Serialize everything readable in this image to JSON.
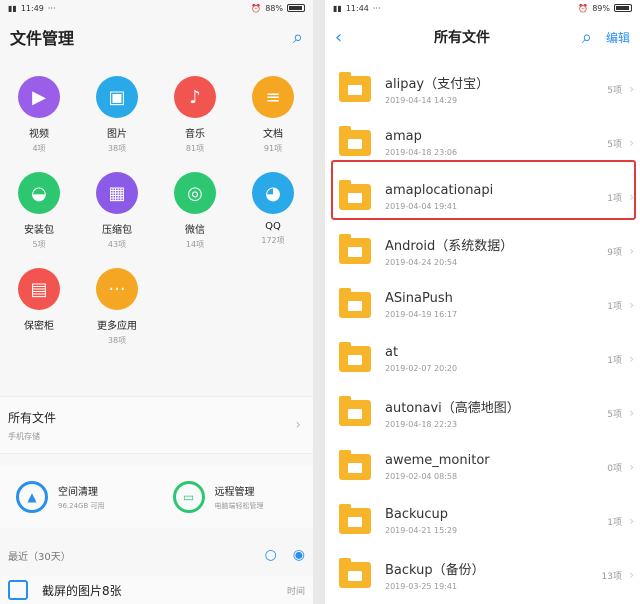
{
  "left": {
    "status": {
      "time": "11:49",
      "battery": "88%"
    },
    "title": "文件管理",
    "categories": [
      {
        "name": "视频",
        "count": "4项",
        "color": "#9b5ee8",
        "icon": "play-icon"
      },
      {
        "name": "图片",
        "count": "38项",
        "color": "#2aa9e8",
        "icon": "image-icon"
      },
      {
        "name": "音乐",
        "count": "81项",
        "color": "#f2554f",
        "icon": "music-icon"
      },
      {
        "name": "文档",
        "count": "91项",
        "color": "#f5a623",
        "icon": "document-icon"
      },
      {
        "name": "安装包",
        "count": "5项",
        "color": "#2ec771",
        "icon": "android-icon"
      },
      {
        "name": "压缩包",
        "count": "43项",
        "color": "#8b5be8",
        "icon": "archive-icon"
      },
      {
        "name": "微信",
        "count": "14项",
        "color": "#2ec771",
        "icon": "wechat-icon"
      },
      {
        "name": "QQ",
        "count": "172项",
        "color": "#2aa9e8",
        "icon": "qq-icon"
      },
      {
        "name": "保密柜",
        "count": "",
        "color": "#f2554f",
        "icon": "safe-icon"
      },
      {
        "name": "更多应用",
        "count": "38项",
        "color": "#f5a623",
        "icon": "more-icon"
      }
    ],
    "all_files": {
      "title": "所有文件",
      "sub": "手机存储"
    },
    "tools": [
      {
        "title": "空间清理",
        "sub": "96.24GB 可用",
        "color": "#2a8ef0"
      },
      {
        "title": "远程管理",
        "sub": "电脑端轻松管理",
        "color": "#2ec771"
      }
    ],
    "recent": {
      "label": "最近（30天）"
    },
    "screenshot_row": {
      "label": "截屏的图片8张",
      "time": "时间"
    }
  },
  "right": {
    "status": {
      "time": "11:44",
      "battery": "89%"
    },
    "title": "所有文件",
    "edit": "编辑",
    "files": [
      {
        "name": "alipay（支付宝）",
        "date": "2019-04-14 14:29",
        "count": "5项"
      },
      {
        "name": "amap",
        "date": "2019-04-18 23:06",
        "count": "5项"
      },
      {
        "name": "amaplocationapi",
        "date": "2019-04-04 19:41",
        "count": "1项"
      },
      {
        "name": "Android（系统数据）",
        "date": "2019-04-24 20:54",
        "count": "9项"
      },
      {
        "name": "ASinaPush",
        "date": "2019-04-19 16:17",
        "count": "1项"
      },
      {
        "name": "at",
        "date": "2019-02-07 20:20",
        "count": "1项"
      },
      {
        "name": "autonavi（高德地图）",
        "date": "2019-04-18 22:23",
        "count": "5项"
      },
      {
        "name": "aweme_monitor",
        "date": "2019-02-04 08:58",
        "count": "0项"
      },
      {
        "name": "Backucup",
        "date": "2019-04-21 15:29",
        "count": "1项"
      },
      {
        "name": "Backup（备份）",
        "date": "2019-03-25 19:41",
        "count": "13项"
      }
    ]
  }
}
